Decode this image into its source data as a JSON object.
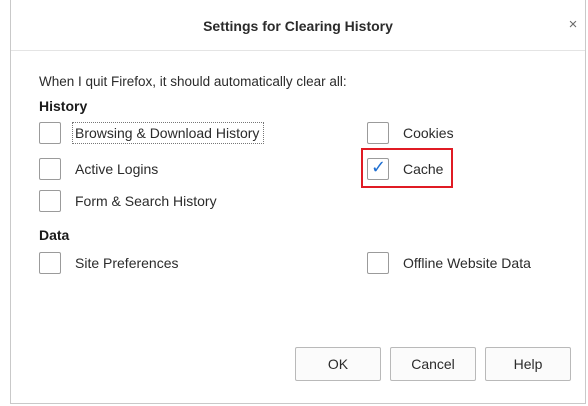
{
  "dialog": {
    "title": "Settings for Clearing History",
    "close_glyph": "×"
  },
  "intro": "When I quit Firefox, it should automatically clear all:",
  "sections": {
    "history": "History",
    "data": "Data"
  },
  "options": {
    "browsing_download_history": {
      "label": "Browsing & Download History",
      "checked": false
    },
    "cookies": {
      "label": "Cookies",
      "checked": false
    },
    "active_logins": {
      "label": "Active Logins",
      "checked": false
    },
    "cache": {
      "label": "Cache",
      "checked": true,
      "check_glyph": "✓"
    },
    "form_search_history": {
      "label": "Form & Search History",
      "checked": false
    },
    "site_preferences": {
      "label": "Site Preferences",
      "checked": false
    },
    "offline_website_data": {
      "label": "Offline Website Data",
      "checked": false
    }
  },
  "buttons": {
    "ok": "OK",
    "cancel": "Cancel",
    "help": "Help"
  },
  "colors": {
    "highlight": "#e01b24",
    "check": "#1f6fd1"
  }
}
